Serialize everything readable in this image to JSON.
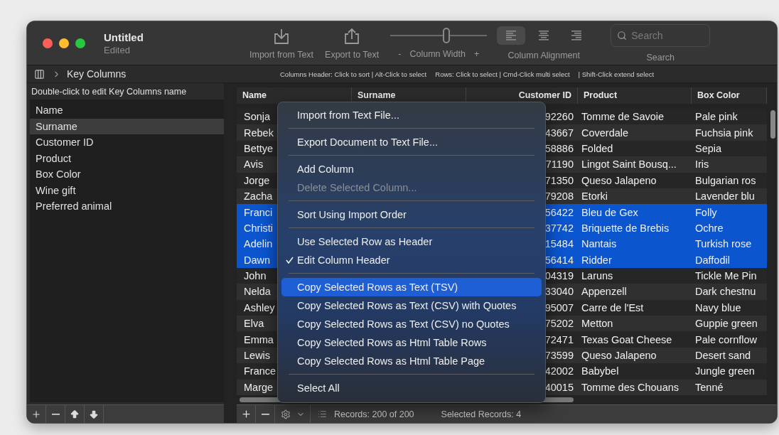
{
  "window": {
    "title": "Untitled",
    "subtitle": "Edited"
  },
  "toolbar": {
    "import": {
      "label": "Import from Text"
    },
    "export": {
      "label": "Export to Text"
    },
    "column_width": {
      "minus": "-",
      "label": "Column Width",
      "plus": "+",
      "level": 0.58
    },
    "alignment": {
      "label": "Column Alignment",
      "options": [
        {
          "kind": "left",
          "selected": true
        },
        {
          "kind": "center",
          "selected": false
        },
        {
          "kind": "right",
          "selected": false
        }
      ]
    },
    "search": {
      "placeholder": "Search",
      "label": "Search"
    }
  },
  "breadcrumb": {
    "label": "Key Columns"
  },
  "hints": [
    "Columns Header: Click to sort | Alt-Click to select",
    "Rows: Click to select | Cmd-Click multi select",
    "| Shift-Click extend select"
  ],
  "sidebar": {
    "hint": "Double-click to edit Key Columns name",
    "items": [
      {
        "label": "Name",
        "selected": false
      },
      {
        "label": "Surname",
        "selected": true
      },
      {
        "label": "Customer ID",
        "selected": false
      },
      {
        "label": "Product",
        "selected": false
      },
      {
        "label": "Box Color",
        "selected": false
      },
      {
        "label": "Wine gift",
        "selected": false
      },
      {
        "label": "Preferred animal",
        "selected": false
      }
    ]
  },
  "table": {
    "columns": [
      "Name",
      "Surname",
      "Customer ID",
      "Product",
      "Box Color"
    ],
    "rows": [
      {
        "name": "Sonja",
        "customer_id": "92260",
        "product": "Tomme de Savoie",
        "box_color": "Pale pink",
        "selected": false
      },
      {
        "name": "Rebek",
        "customer_id": "43667",
        "product": "Coverdale",
        "box_color": "Fuchsia pink",
        "selected": false
      },
      {
        "name": "Bettye",
        "customer_id": "58886",
        "product": "Folded",
        "box_color": "Sepia",
        "selected": false
      },
      {
        "name": "Avis",
        "customer_id": "71190",
        "product": "Lingot Saint Bousq...",
        "box_color": "Iris",
        "selected": false
      },
      {
        "name": "Jorge",
        "customer_id": "71350",
        "product": "Queso Jalapeno",
        "box_color": "Bulgarian ros",
        "selected": false
      },
      {
        "name": "Zacha",
        "customer_id": "79208",
        "product": "Etorki",
        "box_color": "Lavender blu",
        "selected": false
      },
      {
        "name": "Franci",
        "customer_id": "56422",
        "product": "Bleu de Gex",
        "box_color": "Folly",
        "selected": true
      },
      {
        "name": "Christi",
        "customer_id": "37742",
        "product": "Briquette de Brebis",
        "box_color": "Ochre",
        "selected": true
      },
      {
        "name": "Adelin",
        "customer_id": "15484",
        "product": "Nantais",
        "box_color": "Turkish rose",
        "selected": true
      },
      {
        "name": "Dawn",
        "customer_id": "56414",
        "product": "Ridder",
        "box_color": "Daffodil",
        "selected": true
      },
      {
        "name": "John",
        "customer_id": "04319",
        "product": "Laruns",
        "box_color": "Tickle Me Pin",
        "selected": false
      },
      {
        "name": "Nelda",
        "customer_id": "33040",
        "product": "Appenzell",
        "box_color": "Dark chestnu",
        "selected": false
      },
      {
        "name": "Ashley",
        "customer_id": "95007",
        "product": "Carre de l'Est",
        "box_color": "Navy blue",
        "selected": false
      },
      {
        "name": "Elva",
        "customer_id": "75202",
        "product": "Metton",
        "box_color": "Guppie green",
        "selected": false
      },
      {
        "name": "Emma",
        "customer_id": "72471",
        "product": "Texas Goat Cheese",
        "box_color": "Pale cornflow",
        "selected": false
      },
      {
        "name": "Lewis",
        "customer_id": "73599",
        "product": "Queso Jalapeno",
        "box_color": "Desert sand",
        "selected": false
      },
      {
        "name": "France",
        "customer_id": "42002",
        "product": "Babybel",
        "box_color": "Jungle green",
        "selected": false
      },
      {
        "name": "Marge",
        "customer_id": "40015",
        "product": "Tomme des Chouans",
        "box_color": "Tenné",
        "selected": false
      }
    ]
  },
  "menu": [
    {
      "kind": "item",
      "label": "Import  from Text File...",
      "disabled": false,
      "checked": false,
      "selected": false
    },
    {
      "kind": "separator"
    },
    {
      "kind": "item",
      "label": "Export Document to Text File...",
      "disabled": false,
      "checked": false,
      "selected": false
    },
    {
      "kind": "separator"
    },
    {
      "kind": "item",
      "label": "Add Column",
      "disabled": false,
      "checked": false,
      "selected": false
    },
    {
      "kind": "item",
      "label": "Delete Selected Column...",
      "disabled": true,
      "checked": false,
      "selected": false
    },
    {
      "kind": "separator"
    },
    {
      "kind": "item",
      "label": "Sort Using Import Order",
      "disabled": false,
      "checked": false,
      "selected": false
    },
    {
      "kind": "separator"
    },
    {
      "kind": "item",
      "label": "Use Selected Row as Header",
      "disabled": false,
      "checked": false,
      "selected": false
    },
    {
      "kind": "item",
      "label": "Edit Column Header",
      "disabled": false,
      "checked": true,
      "selected": false
    },
    {
      "kind": "separator"
    },
    {
      "kind": "item",
      "label": "Copy Selected Rows as Text (TSV)",
      "disabled": false,
      "checked": false,
      "selected": true
    },
    {
      "kind": "item",
      "label": "Copy Selected Rows as Text (CSV) with Quotes",
      "disabled": false,
      "checked": false,
      "selected": false
    },
    {
      "kind": "item",
      "label": "Copy Selected Rows as Text (CSV) no Quotes",
      "disabled": false,
      "checked": false,
      "selected": false
    },
    {
      "kind": "item",
      "label": "Copy Selected Rows as Html Table Rows",
      "disabled": false,
      "checked": false,
      "selected": false
    },
    {
      "kind": "item",
      "label": "Copy Selected Rows as Html Table Page",
      "disabled": false,
      "checked": false,
      "selected": false
    },
    {
      "kind": "separator"
    },
    {
      "kind": "item",
      "label": "Select All",
      "disabled": false,
      "checked": false,
      "selected": false
    }
  ],
  "sidebar_footer": {
    "buttons": [
      {
        "kind": "plus"
      },
      {
        "kind": "minus"
      },
      {
        "kind": "up"
      },
      {
        "kind": "down"
      }
    ]
  },
  "footer": {
    "records": "Records: 200 of 200",
    "selected": "Selected Records: 4"
  }
}
